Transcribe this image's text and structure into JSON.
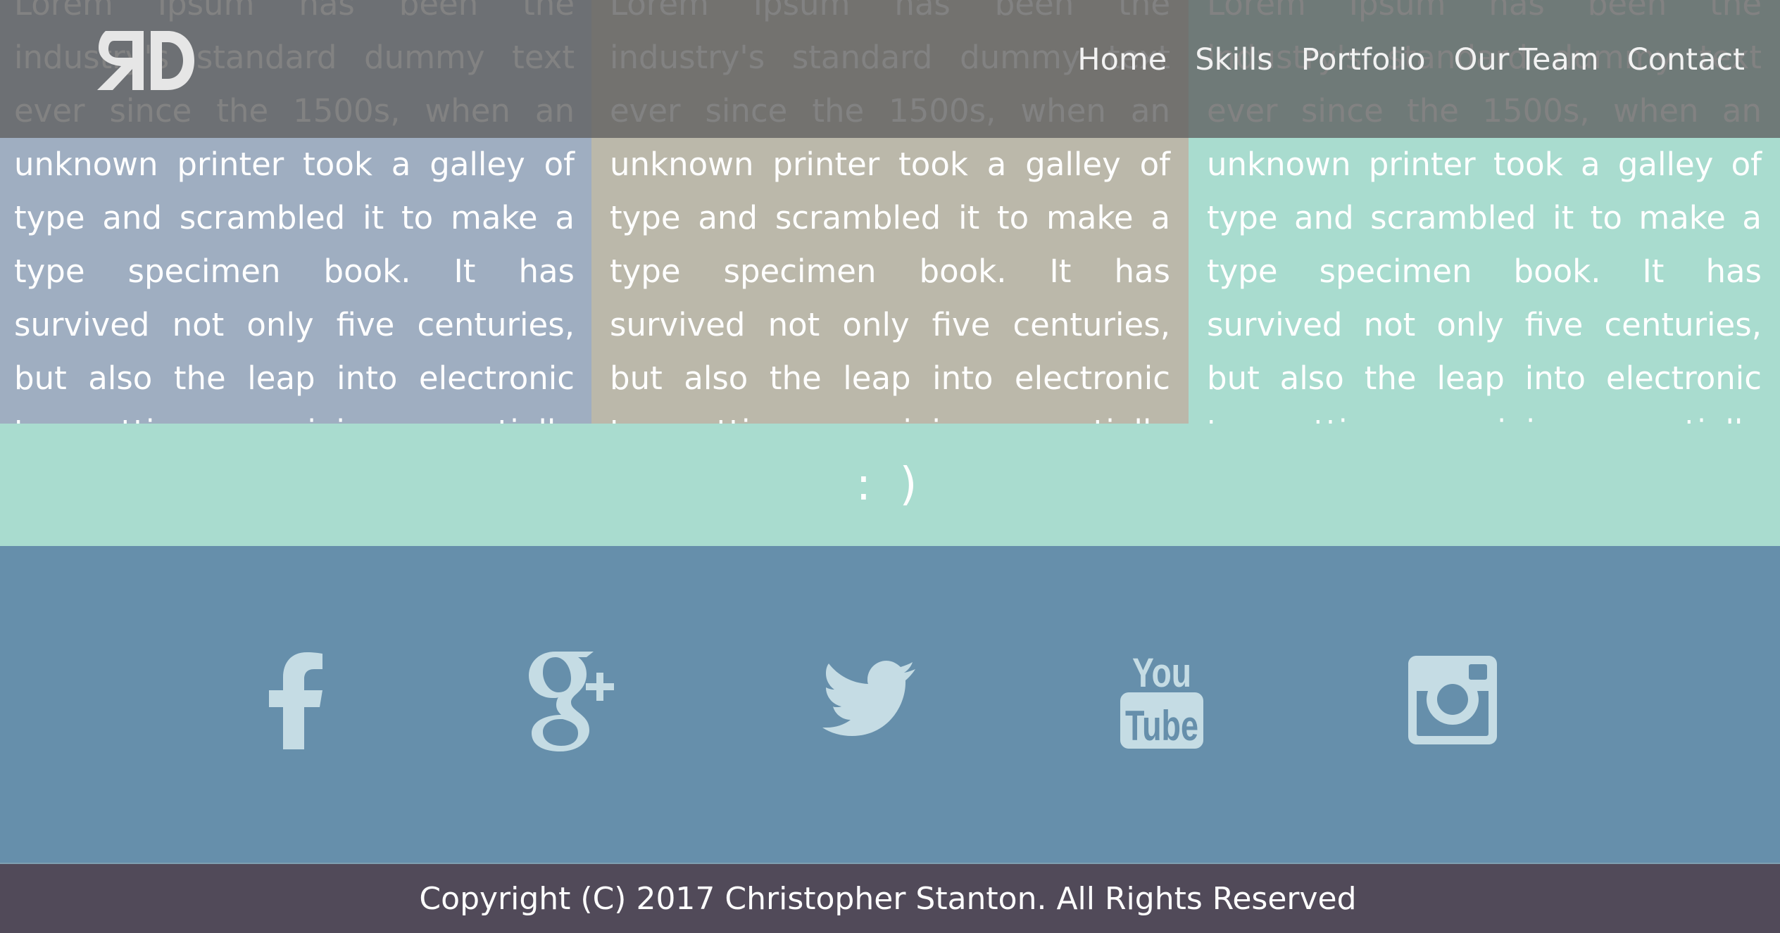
{
  "header": {
    "logo_text": "RD",
    "nav": [
      {
        "label": "Home"
      },
      {
        "label": "Skills"
      },
      {
        "label": "Portfolio"
      },
      {
        "label": "Our Team"
      },
      {
        "label": "Contact"
      }
    ]
  },
  "columns": [
    {
      "text": "Lorem Ipsum has been the industry's standard dummy text ever since the 1500s, when an unknown printer took a galley of type and scrambled it to make a type specimen book. It has survived not only five centuries, but also the leap into electronic typesetting, remaining essentially unchanged."
    },
    {
      "text": "Lorem Ipsum has been the industry's standard dummy text ever since the 1500s, when an unknown printer took a galley of type and scrambled it to make a type specimen book. It has survived not only five centuries, but also the leap into electronic typesetting, remaining essentially unchanged."
    },
    {
      "text": "Lorem Ipsum has been the industry's standard dummy text ever since the 1500s, when an unknown printer took a galley of type and scrambled it to make a type specimen book. It has survived not only five centuries, but also the leap into electronic typesetting, remaining essentially unchanged."
    }
  ],
  "smiley": ": )",
  "social": [
    {
      "icon": "facebook-icon"
    },
    {
      "icon": "google-plus-icon"
    },
    {
      "icon": "twitter-icon"
    },
    {
      "icon": "youtube-icon",
      "text_top": "You",
      "text_bottom": "Tube"
    },
    {
      "icon": "instagram-icon"
    }
  ],
  "footer": {
    "copyright": "Copyright (C) 2017 Christopher Stanton. All Rights Reserved"
  },
  "colors": {
    "column_1": "#9faec1",
    "column_2": "#bbb8aa",
    "column_3": "#a9dccf",
    "social_band": "#668fab",
    "social_icon": "#c5dce4",
    "footer": "#514a59"
  }
}
